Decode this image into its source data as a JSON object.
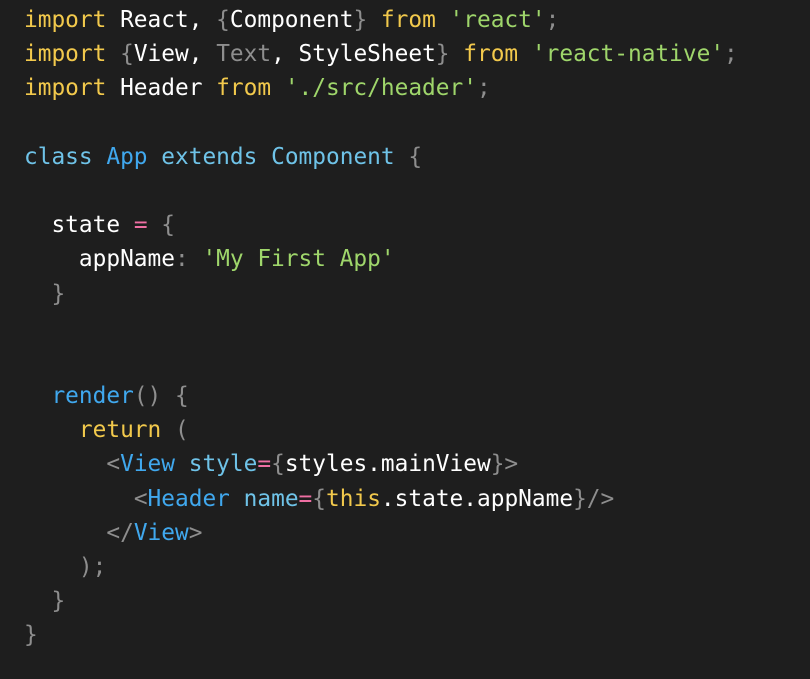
{
  "theme": {
    "background": "#1e1e1e",
    "colors": {
      "keyword": "#f2c94c",
      "string": "#9fd66b",
      "default": "#ffffff",
      "punct": "#8e8e8e",
      "class_kw": "#6fc3e8",
      "type": "#6fc3e8",
      "method": "#40a8ee",
      "operator": "#ef6fa3",
      "tag": "#40a8ee",
      "attr": "#6fc3e8",
      "this": "#f2c94c",
      "dim": "#8e8e8e"
    }
  },
  "editor": {
    "lines": [
      [
        {
          "t": "import",
          "c": "keyword"
        },
        {
          "t": " React, ",
          "c": "default"
        },
        {
          "t": "{",
          "c": "punct"
        },
        {
          "t": "Component",
          "c": "default"
        },
        {
          "t": "} ",
          "c": "punct"
        },
        {
          "t": "from",
          "c": "keyword"
        },
        {
          "t": " ",
          "c": "default"
        },
        {
          "t": "'react'",
          "c": "string"
        },
        {
          "t": ";",
          "c": "punct"
        }
      ],
      [
        {
          "t": "import",
          "c": "keyword"
        },
        {
          "t": " ",
          "c": "default"
        },
        {
          "t": "{",
          "c": "punct"
        },
        {
          "t": "View, ",
          "c": "default"
        },
        {
          "t": "Text",
          "c": "dim"
        },
        {
          "t": ", StyleSheet",
          "c": "default"
        },
        {
          "t": "} ",
          "c": "punct"
        },
        {
          "t": "from",
          "c": "keyword"
        },
        {
          "t": " ",
          "c": "default"
        },
        {
          "t": "'react-native'",
          "c": "string"
        },
        {
          "t": ";",
          "c": "punct"
        }
      ],
      [
        {
          "t": "import",
          "c": "keyword"
        },
        {
          "t": " Header ",
          "c": "default"
        },
        {
          "t": "from",
          "c": "keyword"
        },
        {
          "t": " ",
          "c": "default"
        },
        {
          "t": "'./src/header'",
          "c": "string"
        },
        {
          "t": ";",
          "c": "punct"
        }
      ],
      [],
      [
        {
          "t": "class",
          "c": "class_kw"
        },
        {
          "t": " ",
          "c": "default"
        },
        {
          "t": "App",
          "c": "method"
        },
        {
          "t": " ",
          "c": "default"
        },
        {
          "t": "extends",
          "c": "class_kw"
        },
        {
          "t": " ",
          "c": "default"
        },
        {
          "t": "Component",
          "c": "type"
        },
        {
          "t": " {",
          "c": "punct"
        }
      ],
      [],
      [
        {
          "t": "  state ",
          "c": "default"
        },
        {
          "t": "=",
          "c": "operator"
        },
        {
          "t": " {",
          "c": "punct"
        }
      ],
      [
        {
          "t": "    appName",
          "c": "default"
        },
        {
          "t": ": ",
          "c": "punct"
        },
        {
          "t": "'My First App'",
          "c": "string"
        }
      ],
      [
        {
          "t": "  }",
          "c": "punct"
        }
      ],
      [],
      [],
      [
        {
          "t": "  ",
          "c": "default"
        },
        {
          "t": "render",
          "c": "method"
        },
        {
          "t": "() {",
          "c": "punct"
        }
      ],
      [
        {
          "t": "    ",
          "c": "default"
        },
        {
          "t": "return",
          "c": "keyword"
        },
        {
          "t": " (",
          "c": "punct"
        }
      ],
      [
        {
          "t": "      ",
          "c": "default"
        },
        {
          "t": "<",
          "c": "punct"
        },
        {
          "t": "View",
          "c": "tag"
        },
        {
          "t": " ",
          "c": "default"
        },
        {
          "t": "style",
          "c": "attr"
        },
        {
          "t": "=",
          "c": "operator"
        },
        {
          "t": "{",
          "c": "punct"
        },
        {
          "t": "styles.mainView",
          "c": "default"
        },
        {
          "t": "}>",
          "c": "punct"
        }
      ],
      [
        {
          "t": "        ",
          "c": "default"
        },
        {
          "t": "<",
          "c": "punct"
        },
        {
          "t": "Header",
          "c": "tag"
        },
        {
          "t": " ",
          "c": "default"
        },
        {
          "t": "name",
          "c": "attr"
        },
        {
          "t": "=",
          "c": "operator"
        },
        {
          "t": "{",
          "c": "punct"
        },
        {
          "t": "this",
          "c": "this"
        },
        {
          "t": ".state.appName",
          "c": "default"
        },
        {
          "t": "}/>",
          "c": "punct"
        }
      ],
      [
        {
          "t": "      ",
          "c": "default"
        },
        {
          "t": "</",
          "c": "punct"
        },
        {
          "t": "View",
          "c": "tag"
        },
        {
          "t": ">",
          "c": "punct"
        }
      ],
      [
        {
          "t": "    );",
          "c": "punct"
        }
      ],
      [
        {
          "t": "  }",
          "c": "punct"
        }
      ],
      [
        {
          "t": "}",
          "c": "punct"
        }
      ]
    ]
  }
}
